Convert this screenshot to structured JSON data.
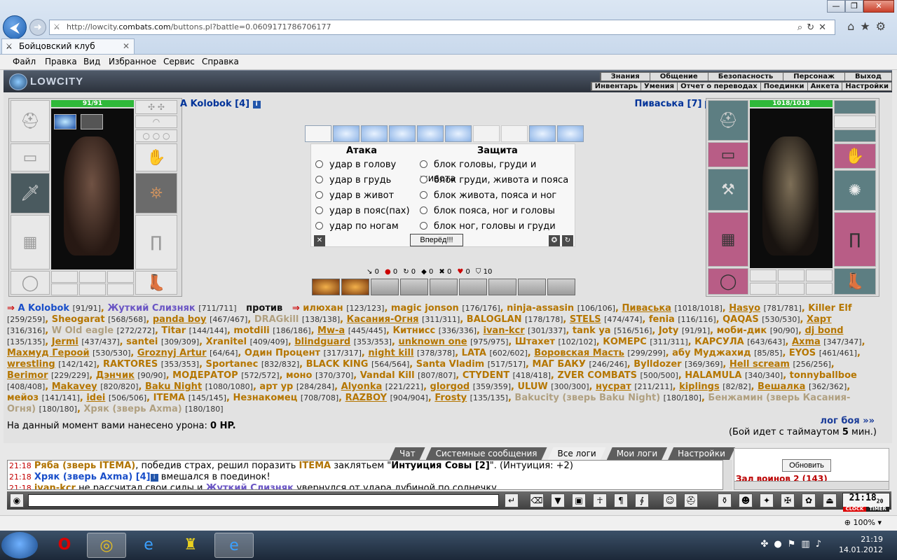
{
  "browser": {
    "url_prefix": "http://lowcity.",
    "url_domain": "combats.com",
    "url_suffix": "/buttons.pl?battle=0.0609171786706177",
    "tab_title": "Бойцовский клуб",
    "menu": [
      "Файл",
      "Правка",
      "Вид",
      "Избранное",
      "Сервис",
      "Справка"
    ],
    "zoom": "100%"
  },
  "game": {
    "logo": "LOWCITY",
    "nav_top": [
      "Знания",
      "Общение",
      "Безопасность",
      "Персонаж",
      "Выход"
    ],
    "nav_bottom": [
      "Инвентарь",
      "Умения",
      "Отчет о переводах",
      "Поединки",
      "Анкета",
      "Настройки"
    ],
    "player_left": {
      "name": "A Kolobok [4]",
      "hp": "91/91",
      "hp_fraction": 1.0
    },
    "player_right": {
      "name": "Пиваська [7]",
      "hp": "1018/1018",
      "hp_fraction": 1.0
    },
    "attack_title": "Атака",
    "defense_title": "Защита",
    "attacks": [
      "удар в голову",
      "удар в грудь",
      "удар в живот",
      "удар в пояс(пах)",
      "удар по ногам"
    ],
    "defenses": [
      "блок головы, груди и живота",
      "блок груди, живота и пояса",
      "блок живота, пояса и ног",
      "блок пояса, ног и головы",
      "блок ног, головы и груди"
    ],
    "go_button": "Вперёд!!!",
    "stats": [
      "0",
      "0",
      "0",
      "0",
      "0",
      "0",
      "10"
    ],
    "versus": "против",
    "damage_text": "На данный момент вами нанесено урона: ",
    "damage_value": "0 HP.",
    "log_link": "лог боя »»",
    "timeout_text": "(Бой идет с таймаутом ",
    "timeout_value": "5",
    "timeout_unit": " мин.)"
  },
  "chat": {
    "tabs": [
      "Чат",
      "Системные сообщения",
      "Все логи",
      "Мои логи",
      "Настройки"
    ],
    "active_tab": "Все логи",
    "lines": [
      {
        "time": "21:18",
        "text1": "Ряба (зверь ITEMA)",
        "text2": ", победив страх, решил поразить ",
        "text3": "ITEMA",
        "text4": " заклятьем \"",
        "text5": "Интуиция Совы [2]",
        "text6": "\". (Интуиция: +2)"
      },
      {
        "time": "21:18",
        "text1": "Хряк (зверь Axma) [4]",
        "text2": " вмешался в поединок!"
      },
      {
        "time": "21:18",
        "text1": "ivan-kcr",
        "text2": " не рассчитал свои силы и ",
        "text3": "Жуткий Слизняк",
        "text4": " увернулся от удара дубиной по солнечку"
      }
    ],
    "refresh": "Обновить",
    "online_text": "Зал воинов 2 (143)"
  },
  "clock": {
    "time": "21:18",
    "sec": "20",
    "label1": "CLOCK",
    "label2": "TIMER"
  },
  "taskbar": {
    "time": "21:19",
    "date": "14.01.2012"
  }
}
